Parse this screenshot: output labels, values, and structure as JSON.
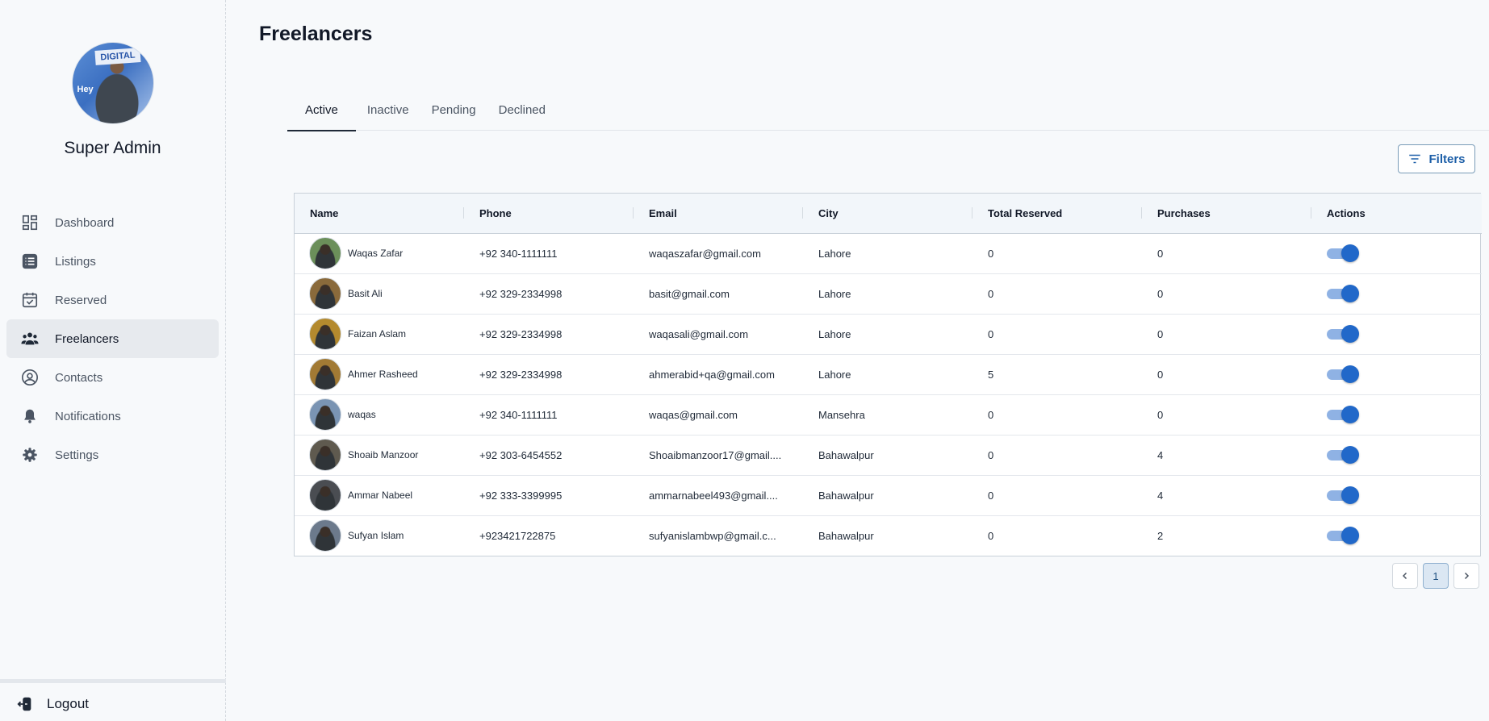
{
  "page": {
    "title": "Freelancers"
  },
  "profile": {
    "name": "Super Admin",
    "avatar_banner": "DIGITAL",
    "avatar_hey": "Hey"
  },
  "sidebar": {
    "items": [
      {
        "label": "Dashboard",
        "icon": "dashboard-icon"
      },
      {
        "label": "Listings",
        "icon": "listings-icon"
      },
      {
        "label": "Reserved",
        "icon": "calendar-check-icon"
      },
      {
        "label": "Freelancers",
        "icon": "users-icon",
        "active": true
      },
      {
        "label": "Contacts",
        "icon": "contact-icon"
      },
      {
        "label": "Notifications",
        "icon": "bell-icon"
      },
      {
        "label": "Settings",
        "icon": "gear-icon"
      }
    ],
    "logout_label": "Logout"
  },
  "tabs": [
    {
      "label": "Active",
      "active": true
    },
    {
      "label": "Inactive"
    },
    {
      "label": "Pending"
    },
    {
      "label": "Declined"
    }
  ],
  "filters_label": "Filters",
  "table": {
    "columns": [
      "Name",
      "Phone",
      "Email",
      "City",
      "Total Reserved",
      "Purchases",
      "Actions"
    ],
    "rows": [
      {
        "name": "Waqas Zafar",
        "phone": "+92 340-1111111",
        "email": "waqaszafar@gmail.com",
        "city": "Lahore",
        "total_reserved": "0",
        "purchases": "0",
        "active": true,
        "avatar_color": "#6b8f5a"
      },
      {
        "name": "Basit Ali",
        "phone": "+92 329-2334998",
        "email": "basit@gmail.com",
        "city": "Lahore",
        "total_reserved": "0",
        "purchases": "0",
        "active": true,
        "avatar_color": "#8a6a3b"
      },
      {
        "name": "Faizan Aslam",
        "phone": "+92 329-2334998",
        "email": "waqasali@gmail.com",
        "city": "Lahore",
        "total_reserved": "0",
        "purchases": "0",
        "active": true,
        "avatar_color": "#b48a2e"
      },
      {
        "name": "Ahmer Rasheed",
        "phone": "+92 329-2334998",
        "email": "ahmerabid+qa@gmail.com",
        "city": "Lahore",
        "total_reserved": "5",
        "purchases": "0",
        "active": true,
        "avatar_color": "#a27a34"
      },
      {
        "name": "waqas",
        "phone": "+92 340-1111111",
        "email": "waqas@gmail.com",
        "city": "Mansehra",
        "total_reserved": "0",
        "purchases": "0",
        "active": true,
        "avatar_color": "#7a94b3"
      },
      {
        "name": "Shoaib Manzoor",
        "phone": "+92 303-6454552",
        "email": "Shoaibmanzoor17@gmail....",
        "city": "Bahawalpur",
        "total_reserved": "0",
        "purchases": "4",
        "active": true,
        "avatar_color": "#5f5a4f"
      },
      {
        "name": "Ammar Nabeel",
        "phone": "+92 333-3399995",
        "email": "ammarnabeel493@gmail....",
        "city": "Bahawalpur",
        "total_reserved": "0",
        "purchases": "4",
        "active": true,
        "avatar_color": "#4a4d52"
      },
      {
        "name": "Sufyan Islam",
        "phone": "+923421722875",
        "email": "sufyanislambwp@gmail.c...",
        "city": "Bahawalpur",
        "total_reserved": "0",
        "purchases": "2",
        "active": true,
        "avatar_color": "#6c7a8c"
      }
    ]
  },
  "pagination": {
    "current": "1"
  }
}
